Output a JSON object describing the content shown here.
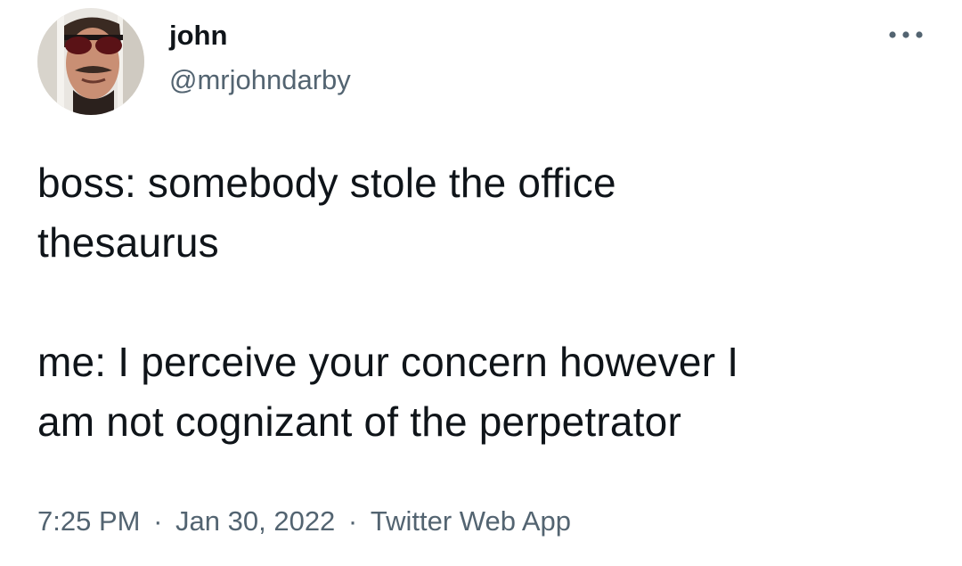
{
  "tweet": {
    "author": {
      "display_name": "john",
      "handle": "@mrjohndarby",
      "avatar_icon": "profile-avatar"
    },
    "more_icon": "more-horizontal-icon",
    "text": "boss: somebody stole the office\nthesaurus\n\nme: I perceive your concern however I\nam not cognizant of the perpetrator",
    "meta": {
      "time": "7:25 PM",
      "separator": "·",
      "date": "Jan 30, 2022",
      "source": "Twitter Web App"
    }
  },
  "colors": {
    "text_primary": "#0f1419",
    "text_secondary": "#536471",
    "background": "#ffffff"
  }
}
